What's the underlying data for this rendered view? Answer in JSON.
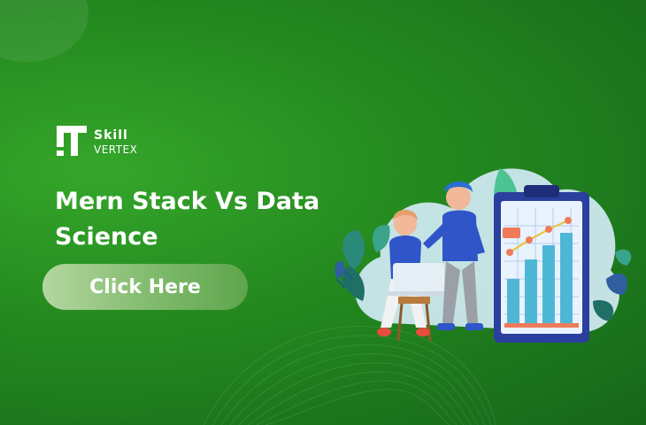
{
  "brand": {
    "name_line1": "Skill",
    "name_line2": "VERTEX",
    "icon": "skill-vertex-logo-mark"
  },
  "headline": "Mern Stack Vs Data Science",
  "cta": {
    "label": "Click Here"
  },
  "illustration": {
    "icons": [
      "woman-with-laptop",
      "man-standing",
      "clipboard-bar-chart",
      "leaves",
      "cloud-blob"
    ]
  },
  "colors": {
    "background": "#23881f",
    "button": "#8fc47d",
    "text": "#ffffff",
    "chart_bar": "#4fb7d6",
    "chart_frame": "#2b3f9e"
  }
}
